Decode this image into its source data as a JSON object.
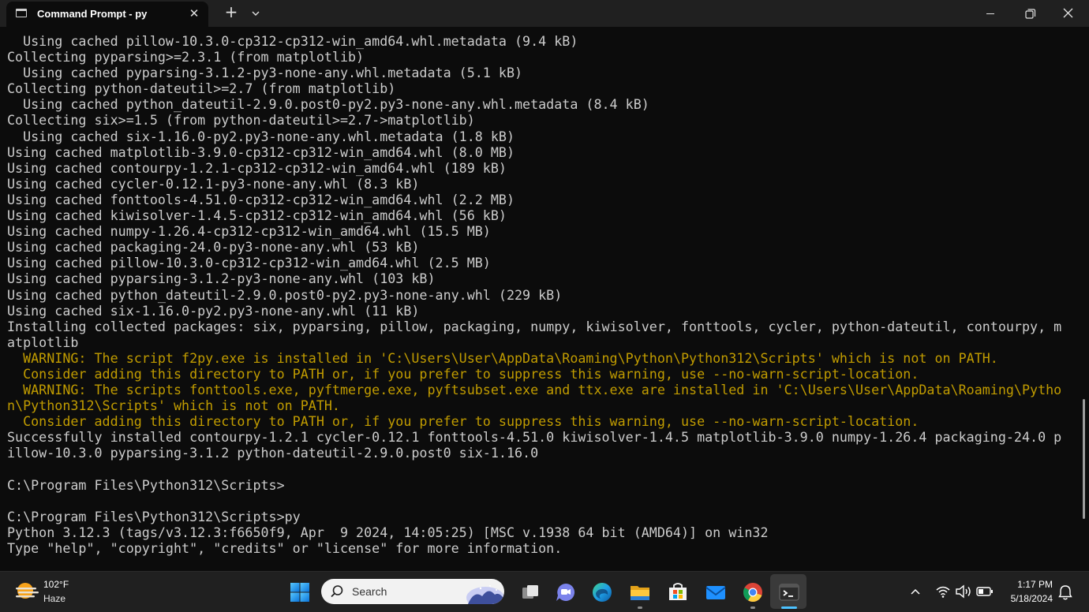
{
  "window": {
    "tab_title": "Command Prompt - py",
    "close_tab_symbol": "✕",
    "new_tab_symbol": "+"
  },
  "terminal": {
    "lines": [
      {
        "text": "  Using cached pillow-10.3.0-cp312-cp312-win_amd64.whl.metadata (9.4 kB)",
        "style": "normal"
      },
      {
        "text": "Collecting pyparsing>=2.3.1 (from matplotlib)",
        "style": "normal"
      },
      {
        "text": "  Using cached pyparsing-3.1.2-py3-none-any.whl.metadata (5.1 kB)",
        "style": "normal"
      },
      {
        "text": "Collecting python-dateutil>=2.7 (from matplotlib)",
        "style": "normal"
      },
      {
        "text": "  Using cached python_dateutil-2.9.0.post0-py2.py3-none-any.whl.metadata (8.4 kB)",
        "style": "normal"
      },
      {
        "text": "Collecting six>=1.5 (from python-dateutil>=2.7->matplotlib)",
        "style": "normal"
      },
      {
        "text": "  Using cached six-1.16.0-py2.py3-none-any.whl.metadata (1.8 kB)",
        "style": "normal"
      },
      {
        "text": "Using cached matplotlib-3.9.0-cp312-cp312-win_amd64.whl (8.0 MB)",
        "style": "normal"
      },
      {
        "text": "Using cached contourpy-1.2.1-cp312-cp312-win_amd64.whl (189 kB)",
        "style": "normal"
      },
      {
        "text": "Using cached cycler-0.12.1-py3-none-any.whl (8.3 kB)",
        "style": "normal"
      },
      {
        "text": "Using cached fonttools-4.51.0-cp312-cp312-win_amd64.whl (2.2 MB)",
        "style": "normal"
      },
      {
        "text": "Using cached kiwisolver-1.4.5-cp312-cp312-win_amd64.whl (56 kB)",
        "style": "normal"
      },
      {
        "text": "Using cached numpy-1.26.4-cp312-cp312-win_amd64.whl (15.5 MB)",
        "style": "normal"
      },
      {
        "text": "Using cached packaging-24.0-py3-none-any.whl (53 kB)",
        "style": "normal"
      },
      {
        "text": "Using cached pillow-10.3.0-cp312-cp312-win_amd64.whl (2.5 MB)",
        "style": "normal"
      },
      {
        "text": "Using cached pyparsing-3.1.2-py3-none-any.whl (103 kB)",
        "style": "normal"
      },
      {
        "text": "Using cached python_dateutil-2.9.0.post0-py2.py3-none-any.whl (229 kB)",
        "style": "normal"
      },
      {
        "text": "Using cached six-1.16.0-py2.py3-none-any.whl (11 kB)",
        "style": "normal"
      },
      {
        "text": "Installing collected packages: six, pyparsing, pillow, packaging, numpy, kiwisolver, fonttools, cycler, python-dateutil, contourpy, m",
        "style": "normal"
      },
      {
        "text": "atplotlib",
        "style": "normal"
      },
      {
        "text": "  WARNING: The script f2py.exe is installed in 'C:\\Users\\User\\AppData\\Roaming\\Python\\Python312\\Scripts' which is not on PATH.",
        "style": "warn"
      },
      {
        "text": "  Consider adding this directory to PATH or, if you prefer to suppress this warning, use --no-warn-script-location.",
        "style": "warn"
      },
      {
        "text": "  WARNING: The scripts fonttools.exe, pyftmerge.exe, pyftsubset.exe and ttx.exe are installed in 'C:\\Users\\User\\AppData\\Roaming\\Pytho",
        "style": "warn"
      },
      {
        "text": "n\\Python312\\Scripts' which is not on PATH.",
        "style": "warn"
      },
      {
        "text": "  Consider adding this directory to PATH or, if you prefer to suppress this warning, use --no-warn-script-location.",
        "style": "warn"
      },
      {
        "text": "Successfully installed contourpy-1.2.1 cycler-0.12.1 fonttools-4.51.0 kiwisolver-1.4.5 matplotlib-3.9.0 numpy-1.26.4 packaging-24.0 p",
        "style": "normal"
      },
      {
        "text": "illow-10.3.0 pyparsing-3.1.2 python-dateutil-2.9.0.post0 six-1.16.0",
        "style": "normal"
      },
      {
        "text": "",
        "style": "normal"
      },
      {
        "text": "C:\\Program Files\\Python312\\Scripts>",
        "style": "normal"
      },
      {
        "text": "",
        "style": "normal"
      },
      {
        "text": "C:\\Program Files\\Python312\\Scripts>py",
        "style": "normal"
      },
      {
        "text": "Python 3.12.3 (tags/v3.12.3:f6650f9, Apr  9 2024, 14:05:25) [MSC v.1938 64 bit (AMD64)] on win32",
        "style": "normal"
      },
      {
        "text": "Type \"help\", \"copyright\", \"credits\" or \"license\" for more information.",
        "style": "normal"
      }
    ]
  },
  "taskbar": {
    "weather": {
      "temp": "102°F",
      "condition": "Haze"
    },
    "search_label": "Search",
    "clock": {
      "time": "1:17 PM",
      "date": "5/18/2024"
    }
  },
  "colors": {
    "terminal_bg": "#0c0c0c",
    "terminal_text": "#cccccc",
    "warning_text": "#c19c00",
    "titlebar_bg": "#202020",
    "taskbar_bg": "#202020",
    "accent": "#4cc2ff"
  },
  "icons": [
    "terminal-tab-icon",
    "close-icon",
    "plus-icon",
    "chevron-down-icon",
    "minimize-icon",
    "maximize-icon",
    "window-close-icon",
    "weather-sun-haze-icon",
    "windows-start-icon",
    "search-icon",
    "task-view-icon",
    "teams-chat-icon",
    "edge-icon",
    "file-explorer-icon",
    "microsoft-store-icon",
    "mail-icon",
    "chrome-icon",
    "terminal-icon",
    "chevron-up-icon",
    "wifi-icon",
    "volume-icon",
    "battery-icon",
    "notification-bell-icon"
  ]
}
